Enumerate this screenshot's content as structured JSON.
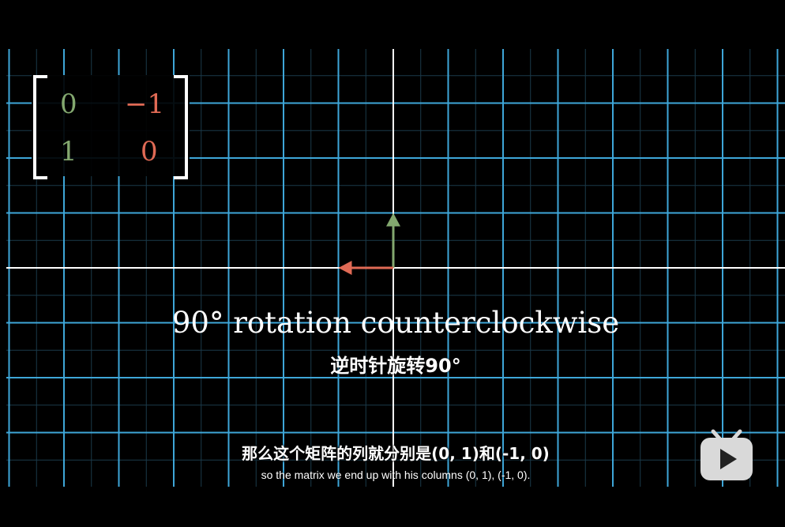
{
  "matrix": {
    "col1": [
      "0",
      "1"
    ],
    "col2": [
      "−1",
      "0"
    ],
    "col1_color": "#83a86f",
    "col2_color": "#e06a55"
  },
  "vectors": {
    "i_hat_after": {
      "x": 0,
      "y": 1,
      "color": "#83a86f"
    },
    "j_hat_after": {
      "x": -1,
      "y": 0,
      "color": "#e06a55"
    }
  },
  "grid": {
    "line_color": "#3ea6d8",
    "axis_color": "#ffffff"
  },
  "captions": {
    "title_en": "90° rotation counterclockwise",
    "title_zh": "逆时针旋转90°"
  },
  "subtitles": {
    "zh": "那么这个矩阵的列就分别是(0, 1)和(-1, 0)",
    "en": "so the matrix we end up with his columns (0, 1), (-1, 0)."
  },
  "player": {
    "logo_icon": "bilibili-tv-play-icon"
  }
}
